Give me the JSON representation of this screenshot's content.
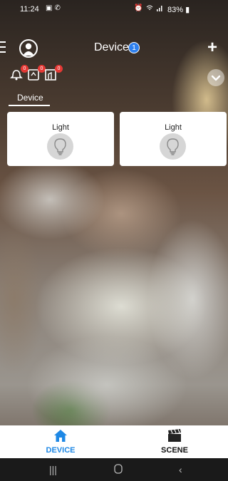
{
  "status_bar": {
    "time": "11:24",
    "left_icons": [
      "gallery-icon",
      "phone-icon"
    ],
    "right_icons": [
      "alarm-icon",
      "wifi-icon",
      "signal-icon"
    ],
    "battery": "83%"
  },
  "header": {
    "title": "Device",
    "badge_count": "1"
  },
  "quick_actions": [
    {
      "icon": "doorbell-icon",
      "badge": "0"
    },
    {
      "icon": "dimmer-icon",
      "badge": "0"
    },
    {
      "icon": "scene-icon",
      "badge": "0"
    }
  ],
  "tabs": [
    {
      "label": "Device",
      "active": true
    }
  ],
  "devices": [
    {
      "label": "Light",
      "icon": "bulb-icon"
    },
    {
      "label": "Light",
      "icon": "bulb-icon"
    }
  ],
  "bottom_nav": [
    {
      "label": "DEVICE",
      "icon": "home-icon",
      "active": true
    },
    {
      "label": "SCENE",
      "icon": "clapperboard-icon",
      "active": false
    }
  ],
  "system_nav": [
    "recents-icon",
    "home-circle-icon",
    "back-icon"
  ],
  "colors": {
    "accent": "#1e88e5",
    "badge": "#e53935",
    "title_badge": "#2f80ed"
  }
}
